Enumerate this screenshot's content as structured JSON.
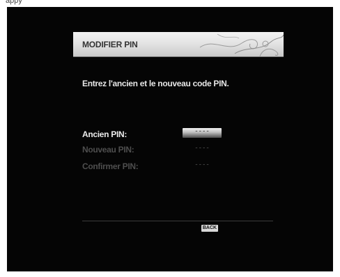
{
  "dialog": {
    "title": "MODIFIER PIN",
    "instruction": "Entrez l'ancien et le nouveau code PIN."
  },
  "fields": [
    {
      "label": "Ancien PIN:",
      "value": "----",
      "active": true
    },
    {
      "label": "Nouveau PIN:",
      "value": "----",
      "active": false
    },
    {
      "label": "Confirmer PIN:",
      "value": "----",
      "active": false
    }
  ],
  "footer": {
    "back_label": "BACK"
  },
  "colors": {
    "background": "#050505",
    "header": "#e2e2e2",
    "active_text": "#ededed",
    "inactive_text": "#4e4e4e"
  }
}
